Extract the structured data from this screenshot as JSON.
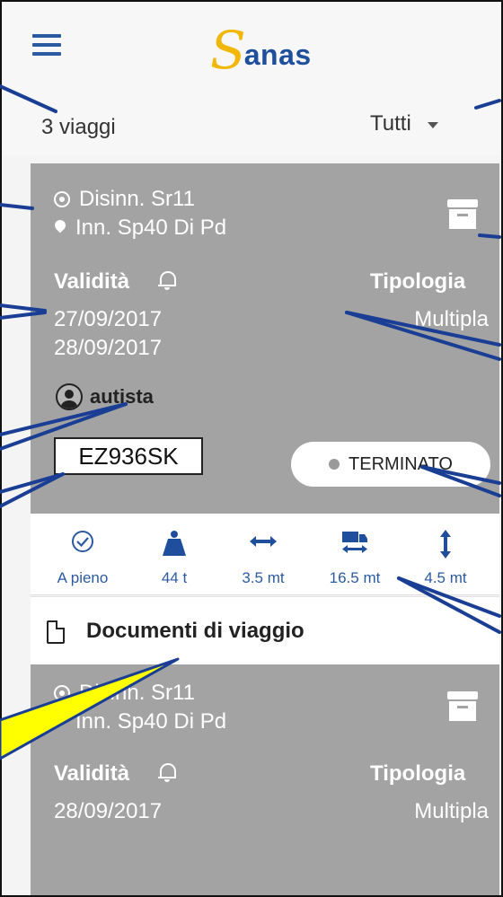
{
  "header": {
    "logo_mark": "S",
    "logo_text": "anas",
    "menu_icon": "hamburger-icon"
  },
  "filter": {
    "count_label": "3 viaggi",
    "selected": "Tutti"
  },
  "trips": [
    {
      "origin": "Disinn. Sr11",
      "destination": "Inn. Sp40 Di Pd",
      "validity_label": "Validità",
      "type_label": "Tipologia",
      "type_value": "Multipla",
      "date_start": "27/09/2017",
      "date_end": "28/09/2017",
      "driver": "autista",
      "plate": "EZ936SK",
      "status": "TERMINATO"
    },
    {
      "origin": "Disinn. Sr11",
      "destination": "Inn. Sp40 Di Pd",
      "validity_label": "Validità",
      "type_label": "Tipologia",
      "type_value": "Multipla",
      "date_start": "28/09/2017"
    }
  ],
  "specs": [
    {
      "icon": "check-circle-icon",
      "value": "A pieno"
    },
    {
      "icon": "weight-icon",
      "value": "44 t"
    },
    {
      "icon": "width-arrows-icon",
      "value": "3.5 mt"
    },
    {
      "icon": "truck-length-icon",
      "value": "16.5 mt"
    },
    {
      "icon": "height-arrows-icon",
      "value": "4.5 mt"
    }
  ],
  "documents": {
    "label": "Documenti di viaggio"
  },
  "colors": {
    "accent": "#2c5aa0",
    "logo_yellow": "#f2b705",
    "card_bg": "#a3a3a3",
    "annotation_line": "#1a3e94",
    "callout": "#ffff00"
  }
}
